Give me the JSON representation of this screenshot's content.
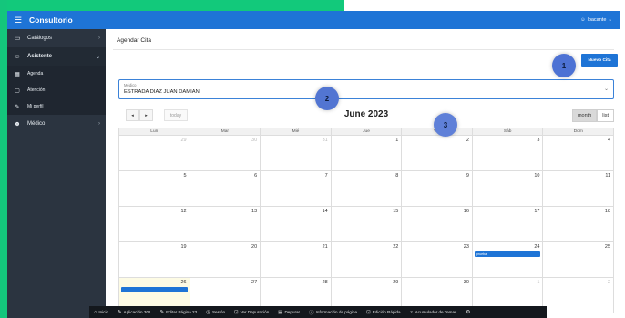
{
  "app": {
    "title": "Consultorio",
    "user": "lpacante"
  },
  "sidebar": {
    "items": [
      {
        "label": "Catálogos",
        "icon": "folder-icon",
        "glyph": "▭",
        "chevron": "›"
      },
      {
        "label": "Asistente",
        "icon": "user-icon",
        "glyph": "☺",
        "chevron": "⌄"
      },
      {
        "label": "Médico",
        "icon": "users-icon",
        "glyph": "☻",
        "chevron": "›"
      }
    ],
    "subitems": [
      {
        "label": "Agenda",
        "icon": "calendar-icon",
        "glyph": "▦"
      },
      {
        "label": "Atención",
        "icon": "clipboard-icon",
        "glyph": "▢"
      },
      {
        "label": "Mi perfil",
        "icon": "user-edit-icon",
        "glyph": "✎"
      }
    ]
  },
  "page": {
    "title": "Agendar Cita",
    "nuevo_cita_label": "Nuevo Cita"
  },
  "medico_select": {
    "label": "Médico",
    "value": "ESTRADA DIAZ JUAN DAMIAN",
    "chevron": "⌄"
  },
  "calendar": {
    "title": "June 2023",
    "prev": "◂",
    "next": "▸",
    "today_label": "today",
    "month_label": "month",
    "list_label": "list",
    "weekdays": [
      "Lun",
      "Mar",
      "Mié",
      "Jue",
      "Vie",
      "Sáb",
      "Dom"
    ],
    "weeks": [
      [
        {
          "n": "29",
          "other": true
        },
        {
          "n": "30",
          "other": true
        },
        {
          "n": "31",
          "other": true
        },
        {
          "n": "1"
        },
        {
          "n": "2"
        },
        {
          "n": "3"
        },
        {
          "n": "4"
        }
      ],
      [
        {
          "n": "5"
        },
        {
          "n": "6"
        },
        {
          "n": "7"
        },
        {
          "n": "8"
        },
        {
          "n": "9"
        },
        {
          "n": "10"
        },
        {
          "n": "11"
        }
      ],
      [
        {
          "n": "12"
        },
        {
          "n": "13"
        },
        {
          "n": "14"
        },
        {
          "n": "15"
        },
        {
          "n": "16"
        },
        {
          "n": "17"
        },
        {
          "n": "18"
        }
      ],
      [
        {
          "n": "19"
        },
        {
          "n": "20"
        },
        {
          "n": "21"
        },
        {
          "n": "22"
        },
        {
          "n": "23"
        },
        {
          "n": "24",
          "event": "prueba"
        },
        {
          "n": "25"
        }
      ],
      [
        {
          "n": "26",
          "today": true,
          "event": ""
        },
        {
          "n": "27"
        },
        {
          "n": "28"
        },
        {
          "n": "29"
        },
        {
          "n": "30"
        },
        {
          "n": "1",
          "other": true
        },
        {
          "n": "2",
          "other": true
        }
      ]
    ]
  },
  "markers": [
    "1",
    "2",
    "3"
  ],
  "devbar": [
    {
      "label": "Inicio",
      "glyph": "⌂",
      "icon": "home-icon"
    },
    {
      "label": "Aplicación 301",
      "glyph": "✎",
      "icon": "edit-icon"
    },
    {
      "label": "Editar Página 23",
      "glyph": "✎",
      "icon": "edit-page-icon"
    },
    {
      "label": "Sesión",
      "glyph": "◷",
      "icon": "session-icon"
    },
    {
      "label": "Ver Depuración",
      "glyph": "⊡",
      "icon": "debug-view-icon"
    },
    {
      "label": "Depurar",
      "glyph": "▤",
      "icon": "debug-icon"
    },
    {
      "label": "Información de página",
      "glyph": "ⓘ",
      "icon": "info-icon"
    },
    {
      "label": "Edición Rápida",
      "glyph": "⊡",
      "icon": "quick-edit-icon"
    },
    {
      "label": "Acumulador de Temas",
      "glyph": "♆",
      "icon": "theme-roller-icon"
    },
    {
      "label": "",
      "glyph": "⚙",
      "icon": "gear-icon"
    }
  ],
  "colors": {
    "primary": "#1e74d6",
    "sidebar": "#2b3440",
    "background_green": "#10c77a"
  }
}
